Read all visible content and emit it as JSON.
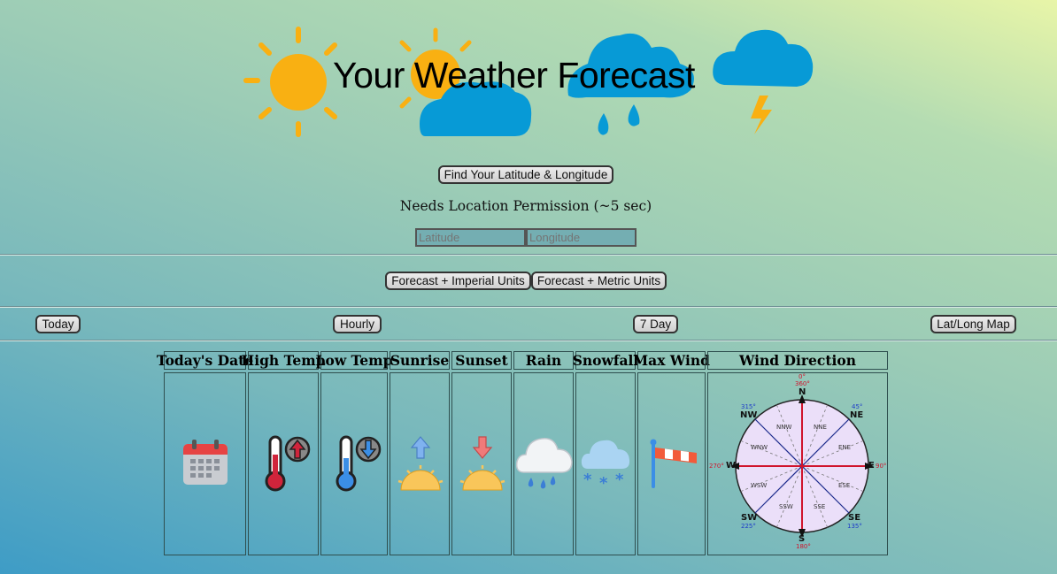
{
  "header": {
    "title": "Your Weather Forecast"
  },
  "location": {
    "find_button_label": "Find Your Latitude & Longitude",
    "permission_note": "Needs Location Permission (~5 sec)",
    "latitude_placeholder": "Latitude",
    "longitude_placeholder": "Longitude"
  },
  "units": {
    "imperial_label": "Forecast + Imperial Units",
    "metric_label": "Forecast + Metric Units"
  },
  "nav": {
    "today": "Today",
    "hourly": "Hourly",
    "seven_day": "7 Day",
    "map": "Lat/Long Map"
  },
  "table": {
    "columns": [
      "Today's Date",
      "High Temp",
      "Low Temp",
      "Sunrise",
      "Sunset",
      "Rain",
      "Snowfall",
      "Max Wind",
      "Wind Direction"
    ],
    "icons": [
      "calendar-icon",
      "thermometer-up-icon",
      "thermometer-down-icon",
      "sunrise-icon",
      "sunset-icon",
      "rain-cloud-icon",
      "snow-cloud-icon",
      "windsock-icon",
      "compass-rose-icon"
    ]
  },
  "compass": {
    "north": "N",
    "north_deg": "0°",
    "north_deg2": "360°",
    "east": "E",
    "east_deg": "90°",
    "south": "S",
    "south_deg": "180°",
    "west": "W",
    "west_deg": "270°",
    "ne": "NE",
    "ne_deg": "45°",
    "se": "SE",
    "se_deg": "135°",
    "sw": "SW",
    "sw_deg": "225°",
    "nw": "NW",
    "nw_deg": "315°",
    "nne": "NNE",
    "ene": "ENE",
    "ese": "ESE",
    "sse": "SSE",
    "ssw": "SSW",
    "wsw": "WSW",
    "wnw": "WNW",
    "nnw": "NNW"
  },
  "colors": {
    "sun": "#f9b012",
    "cloud": "#079ad6",
    "button_border": "#333333"
  }
}
